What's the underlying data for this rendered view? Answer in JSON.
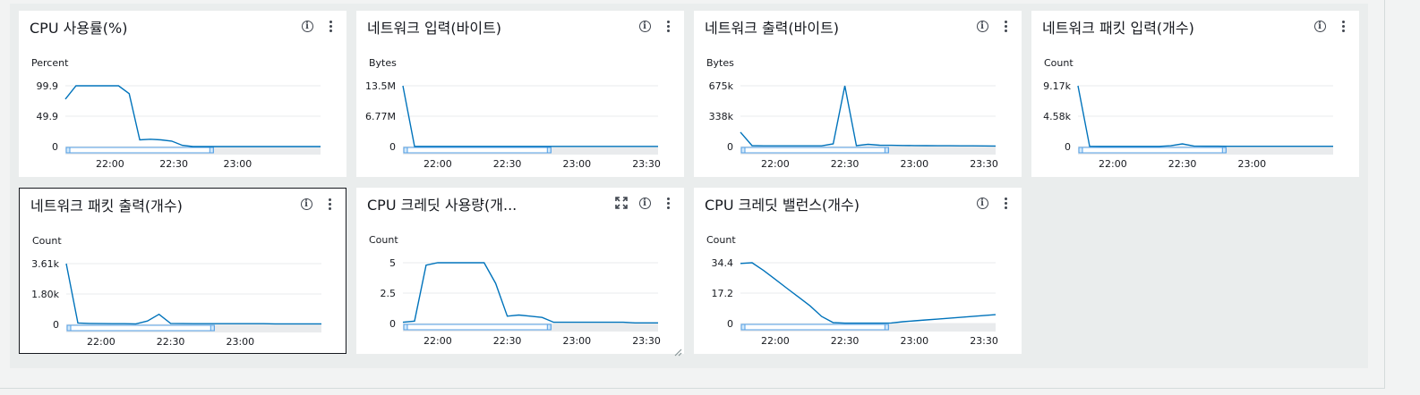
{
  "colors": {
    "line": "#0073bb",
    "grid": "#e9ebed",
    "brush": "#e9ebed"
  },
  "panels": [
    {
      "title": "CPU 사용률(%)",
      "unit": "Percent",
      "yticks": [
        "99.9",
        "49.9",
        "0"
      ],
      "xticks": [
        "22:00",
        "22:30",
        "23:00"
      ],
      "show_expand": false,
      "selected": false,
      "chart_data": {
        "type": "line",
        "ylabel": "Percent",
        "ylim": [
          0,
          99.9
        ],
        "x": [
          "21:39",
          "21:44",
          "21:49",
          "21:54",
          "21:59",
          "22:04",
          "22:09",
          "22:14",
          "22:19",
          "22:24",
          "22:29",
          "22:34",
          "22:39",
          "22:44",
          "22:49",
          "22:54",
          "22:59",
          "23:04",
          "23:09",
          "23:14",
          "23:19",
          "23:24",
          "23:29",
          "23:34",
          "23:39"
        ],
        "series": [
          {
            "values": [
              78,
              99.9,
              99.9,
              99.9,
              99.9,
              99.9,
              87,
              11,
              12,
              11,
              9,
              2,
              0,
              0,
              0,
              0,
              0,
              0,
              0,
              0,
              0,
              0,
              0,
              0,
              0
            ]
          }
        ]
      }
    },
    {
      "title": "네트워크 입력(바이트)",
      "unit": "Bytes",
      "yticks": [
        "13.5M",
        "6.77M",
        "0"
      ],
      "xticks": [
        "22:00",
        "22:30",
        "23:00",
        "23:30"
      ],
      "show_expand": false,
      "selected": false,
      "chart_data": {
        "type": "line",
        "ylabel": "Bytes",
        "ylim": [
          0,
          13500000
        ],
        "x": [
          "21:45",
          "21:50",
          "21:55",
          "22:00",
          "22:05",
          "22:10",
          "22:15",
          "22:20",
          "22:25",
          "22:30",
          "22:35",
          "22:40",
          "22:45",
          "22:50",
          "22:55",
          "23:00",
          "23:05",
          "23:10",
          "23:15",
          "23:20",
          "23:25",
          "23:30",
          "23:35"
        ],
        "series": [
          {
            "values": [
              13500000,
              40000,
              30000,
              30000,
              30000,
              30000,
              30000,
              30000,
              30000,
              30000,
              30000,
              30000,
              30000,
              30000,
              30000,
              30000,
              30000,
              30000,
              30000,
              30000,
              30000,
              30000,
              30000
            ]
          }
        ]
      }
    },
    {
      "title": "네트워크 출력(바이트)",
      "unit": "Bytes",
      "yticks": [
        "675k",
        "338k",
        "0"
      ],
      "xticks": [
        "22:00",
        "22:30",
        "23:00",
        "23:30"
      ],
      "show_expand": false,
      "selected": false,
      "chart_data": {
        "type": "line",
        "ylabel": "Bytes",
        "ylim": [
          0,
          675000
        ],
        "x": [
          "21:45",
          "21:50",
          "21:55",
          "22:00",
          "22:05",
          "22:10",
          "22:15",
          "22:20",
          "22:25",
          "22:30",
          "22:35",
          "22:40",
          "22:45",
          "22:50",
          "22:55",
          "23:00",
          "23:05",
          "23:10",
          "23:15",
          "23:20",
          "23:25",
          "23:30",
          "23:35"
        ],
        "series": [
          {
            "values": [
              160000,
              10000,
              8000,
              8000,
              8000,
              8000,
              8000,
              8000,
              30000,
              675000,
              10000,
              25000,
              15000,
              14000,
              12000,
              11000,
              10000,
              9000,
              9000,
              8000,
              8000,
              7000,
              6000
            ]
          }
        ]
      }
    },
    {
      "title": "네트워크 패킷 입력(개수)",
      "unit": "Count",
      "yticks": [
        "9.17k",
        "4.58k",
        "0"
      ],
      "xticks": [
        "22:00",
        "22:30",
        "23:00"
      ],
      "show_expand": false,
      "selected": false,
      "chart_data": {
        "type": "line",
        "ylabel": "Count",
        "ylim": [
          0,
          9170
        ],
        "x": [
          "21:45",
          "21:50",
          "21:55",
          "22:00",
          "22:05",
          "22:10",
          "22:15",
          "22:20",
          "22:25",
          "22:30",
          "22:35",
          "22:40",
          "22:45",
          "22:50",
          "22:55",
          "23:00",
          "23:05",
          "23:10",
          "23:15",
          "23:20",
          "23:25",
          "23:30",
          "23:35"
        ],
        "series": [
          {
            "values": [
              9170,
              40,
              30,
              30,
              30,
              30,
              30,
              30,
              120,
              400,
              80,
              60,
              50,
              40,
              40,
              40,
              40,
              40,
              40,
              40,
              40,
              40,
              40
            ]
          }
        ]
      }
    },
    {
      "title": "네트워크 패킷 출력(개수)",
      "unit": "Count",
      "yticks": [
        "3.61k",
        "1.80k",
        "0"
      ],
      "xticks": [
        "22:00",
        "22:30",
        "23:00"
      ],
      "show_expand": false,
      "selected": true,
      "chart_data": {
        "type": "line",
        "ylabel": "Count",
        "ylim": [
          0,
          3610
        ],
        "x": [
          "21:45",
          "21:50",
          "21:55",
          "22:00",
          "22:05",
          "22:10",
          "22:15",
          "22:20",
          "22:25",
          "22:30",
          "22:35",
          "22:40",
          "22:45",
          "22:50",
          "22:55",
          "23:00",
          "23:05",
          "23:10",
          "23:15",
          "23:20",
          "23:25",
          "23:30",
          "23:35"
        ],
        "series": [
          {
            "values": [
              3610,
              80,
              60,
              50,
              40,
              40,
              30,
              200,
              600,
              60,
              50,
              40,
              40,
              40,
              40,
              40,
              40,
              40,
              30,
              30,
              30,
              30,
              30
            ]
          }
        ]
      }
    },
    {
      "title": "CPU 크레딧 사용량(개...",
      "unit": "Count",
      "yticks": [
        "5",
        "2.5",
        "0"
      ],
      "xticks": [
        "22:00",
        "22:30",
        "23:00",
        "23:30"
      ],
      "show_expand": true,
      "selected": false,
      "chart_data": {
        "type": "line",
        "ylabel": "Count",
        "ylim": [
          0,
          5
        ],
        "x": [
          "21:45",
          "21:50",
          "21:55",
          "22:00",
          "22:05",
          "22:10",
          "22:15",
          "22:20",
          "22:25",
          "22:30",
          "22:35",
          "22:40",
          "22:45",
          "22:50",
          "22:55",
          "23:00",
          "23:05",
          "23:10",
          "23:15",
          "23:20",
          "23:25",
          "23:30",
          "23:35"
        ],
        "series": [
          {
            "values": [
              0.1,
              0.2,
              4.8,
              5,
              5,
              5,
              5,
              5,
              3.3,
              0.6,
              0.7,
              0.6,
              0.5,
              0.1,
              0.1,
              0.1,
              0.1,
              0.1,
              0.1,
              0.1,
              0.05,
              0.05,
              0.05
            ]
          }
        ]
      }
    },
    {
      "title": "CPU 크레딧 밸런스(개수)",
      "unit": "Count",
      "yticks": [
        "34.4",
        "17.2",
        "0"
      ],
      "xticks": [
        "22:00",
        "22:30",
        "23:00",
        "23:30"
      ],
      "show_expand": false,
      "selected": false,
      "chart_data": {
        "type": "line",
        "ylabel": "Count",
        "ylim": [
          0,
          34.4
        ],
        "x": [
          "21:45",
          "21:50",
          "21:55",
          "22:00",
          "22:05",
          "22:10",
          "22:15",
          "22:20",
          "22:25",
          "22:30",
          "22:35",
          "22:40",
          "22:45",
          "22:50",
          "22:55",
          "23:00",
          "23:05",
          "23:10",
          "23:15",
          "23:20",
          "23:25",
          "23:30",
          "23:35"
        ],
        "series": [
          {
            "values": [
              34,
              34.4,
              30,
              25,
              20,
              15,
              10,
              4,
              0.5,
              0.2,
              0.2,
              0.2,
              0.2,
              0.3,
              1,
              1.5,
              2,
              2.5,
              3,
              3.5,
              4,
              4.5,
              5
            ]
          }
        ]
      }
    }
  ]
}
